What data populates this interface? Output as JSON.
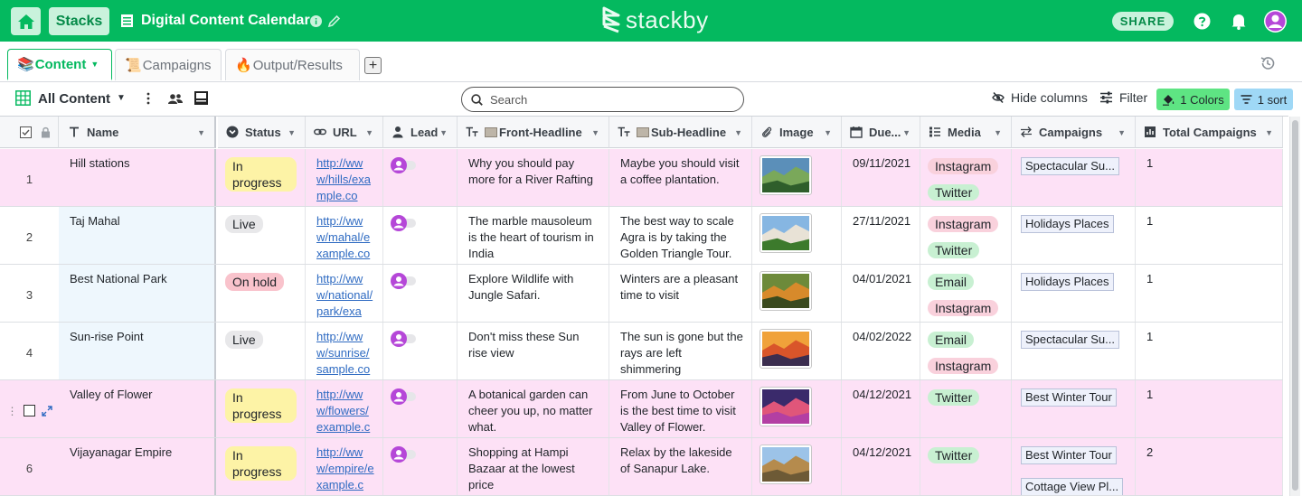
{
  "topbar": {
    "stacks_label": "Stacks",
    "title": "Digital Content Calendar",
    "logo_text": "stackby",
    "share_label": "SHARE",
    "colors": {
      "bar": "#04b95f",
      "button": "#c9f2dc",
      "avatar": "#b547d8"
    }
  },
  "tabs": [
    {
      "emoji": "📚",
      "label": "Content",
      "active": true
    },
    {
      "emoji": "📜",
      "label": "Campaigns",
      "active": false
    },
    {
      "emoji": "🔥",
      "label": "Output/Results",
      "active": false
    }
  ],
  "add_tab_label": "+",
  "toolbar": {
    "view_name": "All Content",
    "search_placeholder": "Search",
    "hide_columns": "Hide columns",
    "filter": "Filter",
    "colors": "1 Colors",
    "sort": "1 sort"
  },
  "columns": [
    {
      "label": "Name",
      "icon": "text-type-icon"
    },
    {
      "label": "Status",
      "icon": "status-icon"
    },
    {
      "label": "URL",
      "icon": "link-icon"
    },
    {
      "label": "Lead",
      "icon": "person-icon"
    },
    {
      "label": "Front-Headline",
      "icon": "text-size-icon"
    },
    {
      "label": "Sub-Headline",
      "icon": "text-size-icon"
    },
    {
      "label": "Image",
      "icon": "paperclip-icon"
    },
    {
      "label": "Due...",
      "icon": "calendar-icon"
    },
    {
      "label": "Media",
      "icon": "list-icon"
    },
    {
      "label": "Campaigns",
      "icon": "link-arrows-icon"
    },
    {
      "label": "Total Campaigns",
      "icon": "rollup-icon"
    }
  ],
  "rows": [
    {
      "num": "1",
      "name": "Hill stations",
      "status": "In progress",
      "url": "http://www/hills/example.co",
      "front": "Why you should pay more for a River Rafting",
      "sub": "Maybe you should visit a coffee plantation.",
      "due": "09/11/2021",
      "media": [
        "Instagram",
        "Twitter"
      ],
      "campaigns": [
        "Spectacular Su..."
      ],
      "total": "1"
    },
    {
      "num": "2",
      "name": "Taj Mahal",
      "status": "Live",
      "url": "http://www/mahal/example.co",
      "front": "The marble mausoleum is the heart of tourism in India",
      "sub": "The best way to scale Agra is by taking the Golden Triangle Tour.",
      "due": "27/11/2021",
      "media": [
        "Instagram",
        "Twitter"
      ],
      "campaigns": [
        "Holidays Places"
      ],
      "total": "1"
    },
    {
      "num": "3",
      "name": "Best National Park",
      "status": "On hold",
      "url": "http://www/national/park/exa",
      "front": "Explore Wildlife with Jungle Safari.",
      "sub": "Winters are a pleasant time to visit",
      "due": "04/01/2021",
      "media": [
        "Email",
        "Instagram"
      ],
      "campaigns": [
        "Holidays Places"
      ],
      "total": "1"
    },
    {
      "num": "4",
      "name": "Sun-rise Point",
      "status": "Live",
      "url": "http://www/sunrise/sample.co",
      "front": "Don't miss these Sun rise view",
      "sub": "The sun is gone but the rays are left shimmering",
      "due": "04/02/2022",
      "media": [
        "Email",
        "Instagram"
      ],
      "campaigns": [
        "Spectacular Su..."
      ],
      "total": "1"
    },
    {
      "num": "",
      "name": "Valley of Flower",
      "status": "In progress",
      "url": "http://www/flowers/example.c",
      "front": "A botanical garden can cheer you up, no matter what.",
      "sub": "From June to October is the best time to visit Valley of Flower.",
      "due": "04/12/2021",
      "media": [
        "Twitter"
      ],
      "campaigns": [
        "Best Winter Tour"
      ],
      "total": "1"
    },
    {
      "num": "6",
      "name": "Vijayanagar Empire",
      "status": "In progress",
      "url": "http://www/empire/example.c",
      "front": "Shopping at Hampi Bazaar at the lowest price",
      "sub": "Relax by the lakeside of Sanapur Lake.",
      "due": "04/12/2021",
      "media": [
        "Twitter"
      ],
      "campaigns": [
        "Best Winter Tour",
        "Cottage View Pl..."
      ],
      "total": "2"
    }
  ]
}
